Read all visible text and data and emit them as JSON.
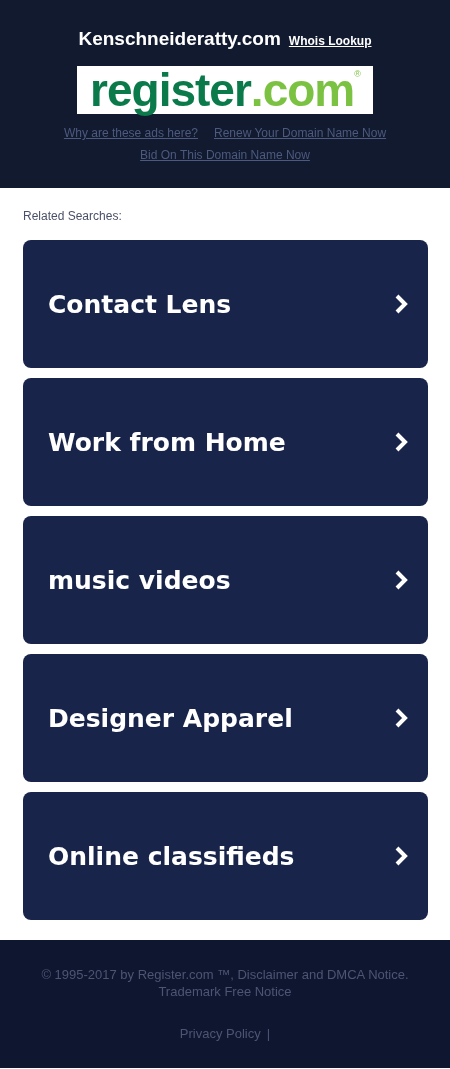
{
  "header": {
    "domain": "Kenschneideratty.com",
    "whois_link": "Whois Lookup",
    "logo": {
      "name": "register",
      "suffix": ".com",
      "mark": "®"
    },
    "links": [
      "Why are these ads here?",
      "Renew Your Domain Name Now",
      "Bid On This Domain Name Now"
    ]
  },
  "related": {
    "title": "Related Searches:",
    "items": [
      {
        "label": "Contact Lens"
      },
      {
        "label": "Work from Home"
      },
      {
        "label": "music videos"
      },
      {
        "label": "Designer Apparel"
      },
      {
        "label": "Online classifieds"
      }
    ]
  },
  "footer": {
    "copyright": "© 1995-2017 by Register.com ™, Disclaimer and DMCA Notice. Trademark Free Notice",
    "links": [
      "Privacy Policy"
    ],
    "separator": "|"
  }
}
